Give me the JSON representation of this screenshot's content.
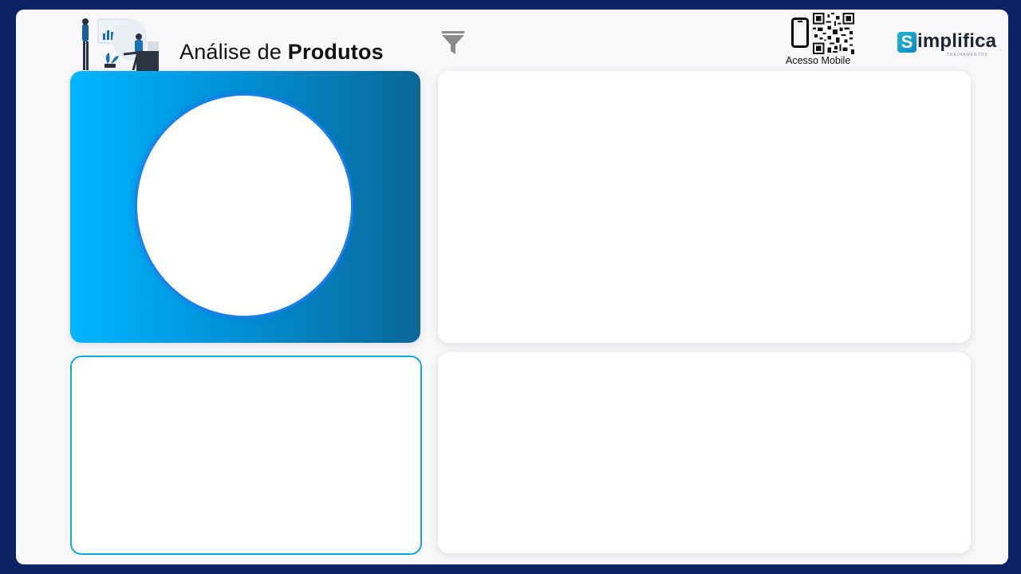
{
  "header": {
    "title_regular": "Análise de",
    "title_bold": "Produtos",
    "mobile_caption": "Acesso Mobile",
    "logo_word": "implifica",
    "logo_letter": "S",
    "logo_sub": "TREINAMENTOS"
  },
  "icons": {
    "filter": "filter-icon",
    "phone": "phone-icon",
    "qr": "qr-code",
    "illustration": "analytics-people-illustration"
  },
  "colors": {
    "background": "#0b2265",
    "canvas": "#f8f8fb",
    "gradient_start": "#00b6ff",
    "gradient_end": "#0a6797",
    "accent_border": "#0aaae0"
  }
}
